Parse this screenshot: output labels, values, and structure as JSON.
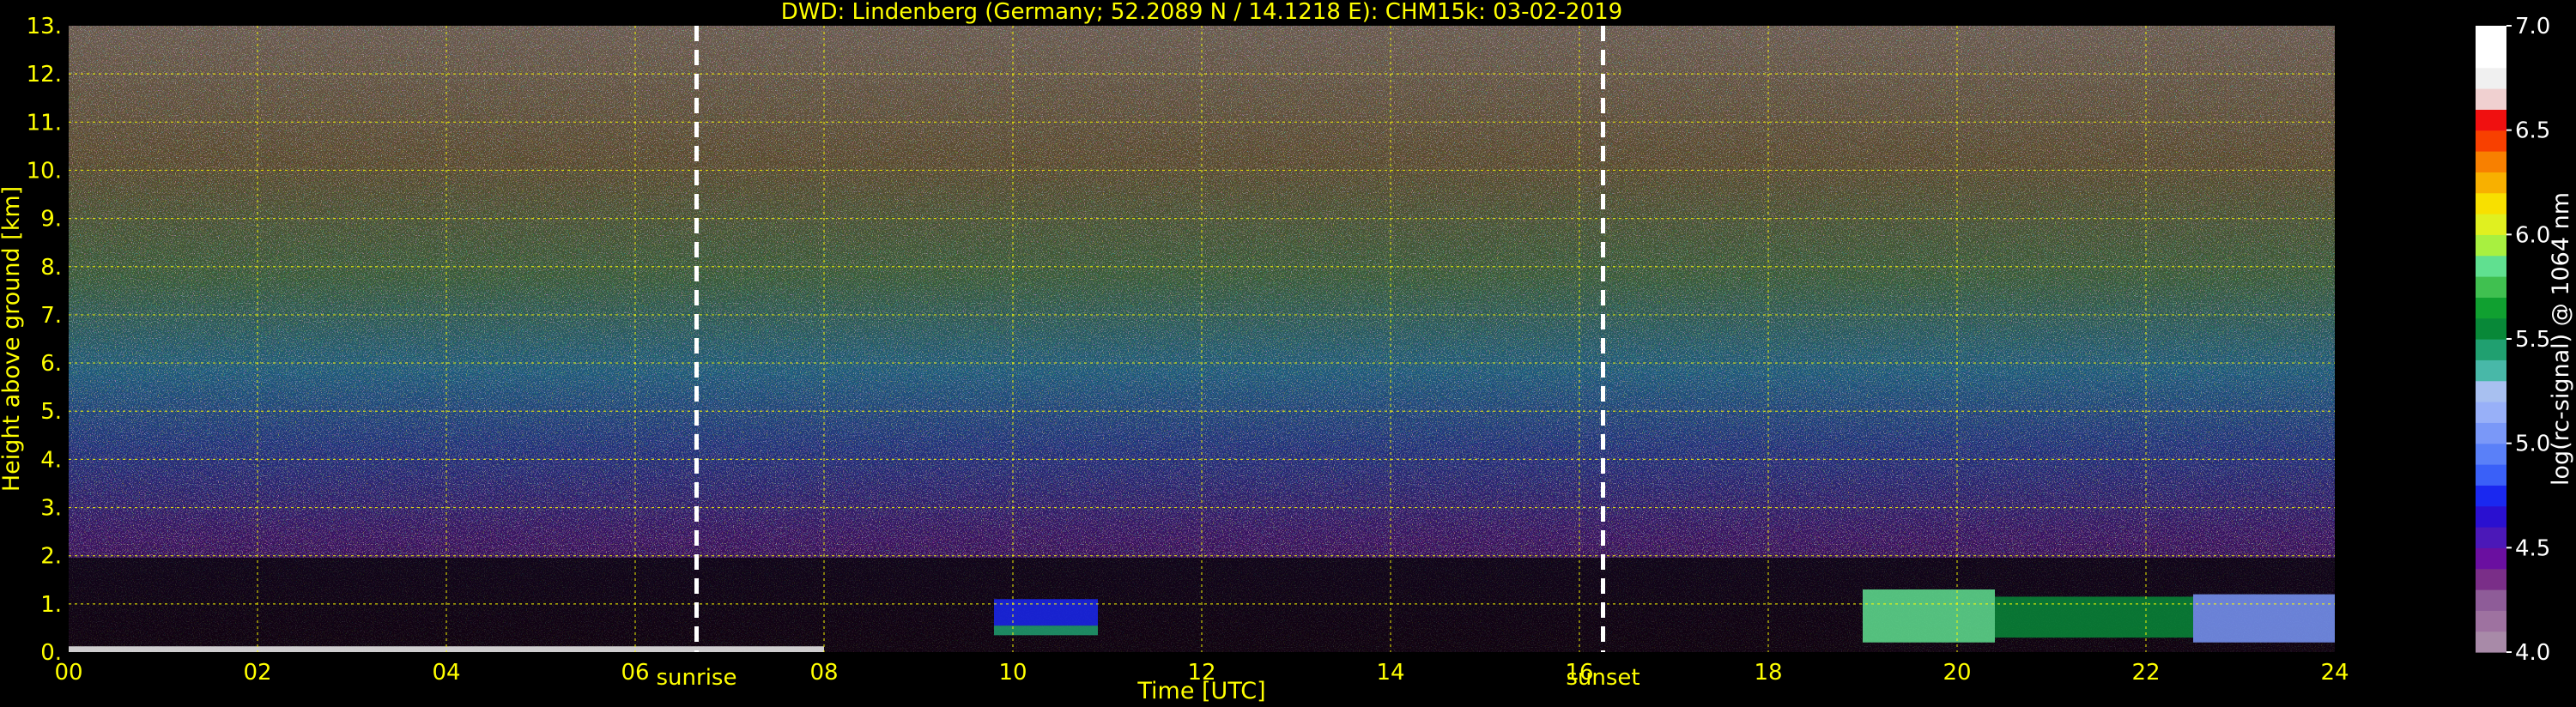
{
  "chart_data": {
    "type": "heatmap",
    "title": "DWD: Lindenberg (Germany; 52.2089 N / 14.1218 E):    CHM15k: 03-02-2019",
    "xlabel": "Time [UTC]",
    "ylabel": "Height above ground [km]",
    "xlim": [
      0,
      24
    ],
    "ylim": [
      0,
      13
    ],
    "x_ticks": [
      "00",
      "02",
      "04",
      "06",
      "08",
      "10",
      "12",
      "14",
      "16",
      "18",
      "20",
      "22",
      "24"
    ],
    "y_ticks": [
      "0.",
      "1.",
      "2.",
      "3.",
      "4.",
      "5.",
      "6.",
      "7.",
      "8.",
      "9.",
      "10.",
      "11.",
      "12.",
      "13."
    ],
    "grid": true,
    "markers": [
      {
        "label": "sunrise",
        "x": 6.65
      },
      {
        "label": "sunset",
        "x": 16.25
      }
    ],
    "colorbar": {
      "label": "log(rc-signal) @ 1064 nm",
      "range": [
        4.0,
        7.0
      ],
      "ticks": [
        "4.0",
        "4.5",
        "5.0",
        "5.5",
        "6.0",
        "6.5",
        "7.0"
      ],
      "colors": [
        "#a88aa8",
        "#9e72a0",
        "#8e5c98",
        "#7a2e88",
        "#6a0fa0",
        "#4b18b8",
        "#2a10d0",
        "#1a28f0",
        "#3a60f8",
        "#5a80f8",
        "#7a98f8",
        "#98b0f8",
        "#a8c0f0",
        "#48b8a8",
        "#20a070",
        "#088838",
        "#10a030",
        "#40c050",
        "#60e090",
        "#a8f040",
        "#e0f020",
        "#f8e000",
        "#f8b000",
        "#f88000",
        "#f84000",
        "#f01010",
        "#f0d0d0",
        "#f0f0f0",
        "#ffffff",
        "#ffffff"
      ]
    },
    "colors": {
      "text": "#ffff00",
      "grid": "#ffff00",
      "background": "#000000",
      "markers": "#ffffff"
    },
    "features": [
      {
        "x": [
          0,
          8
        ],
        "y": [
          0.0,
          0.12
        ],
        "value": 6.8
      },
      {
        "x": [
          9.8,
          10.9
        ],
        "y": [
          0.35,
          0.55
        ],
        "value": 5.4
      },
      {
        "x": [
          9.8,
          10.9
        ],
        "y": [
          0.55,
          1.1
        ],
        "value": 4.8
      },
      {
        "x": [
          19,
          20.4
        ],
        "y": [
          0.2,
          1.3
        ],
        "value": 5.8
      },
      {
        "x": [
          20.4,
          22.5
        ],
        "y": [
          0.3,
          1.15
        ],
        "value": 5.6
      },
      {
        "x": [
          22.5,
          24
        ],
        "y": [
          0.2,
          1.2
        ],
        "value": 5.0
      }
    ]
  }
}
